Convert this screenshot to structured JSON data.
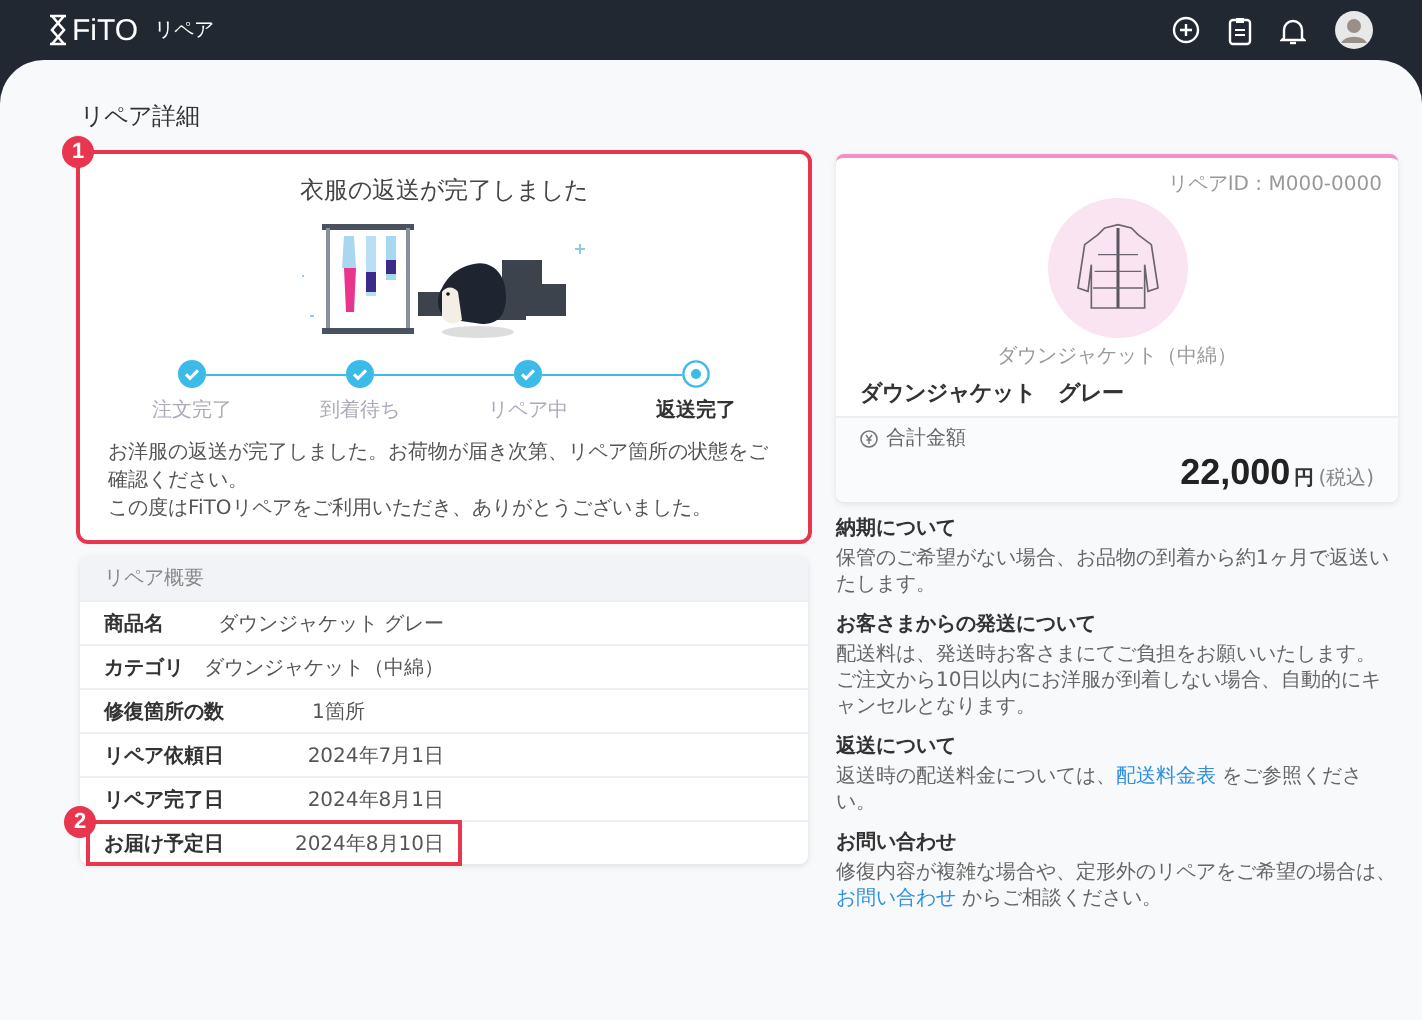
{
  "header": {
    "logo": "FiTO",
    "service": "リペア"
  },
  "page_title": "リペア詳細",
  "status_card": {
    "annotation": "1",
    "title": "衣服の返送が完了しました",
    "steps": [
      {
        "label": "注文完了",
        "done": true,
        "current": false
      },
      {
        "label": "到着待ち",
        "done": true,
        "current": false
      },
      {
        "label": "リペア中",
        "done": true,
        "current": false
      },
      {
        "label": "返送完了",
        "done": false,
        "current": true
      }
    ],
    "messages": [
      "お洋服の返送が完了しました。お荷物が届き次第、リペア箇所の状態をご確認ください。",
      "この度はFiTOリペアをご利用いただき、ありがとうございました。"
    ]
  },
  "summary": {
    "title": "リペア概要",
    "rows": [
      {
        "label": "商品名",
        "value": "ダウンジャケット グレー"
      },
      {
        "label": "カテゴリ",
        "value": "ダウンジャケット（中綿）"
      },
      {
        "label": "修復箇所の数",
        "value": "1箇所"
      },
      {
        "label": "リペア依頼日",
        "value": "2024年7月1日"
      },
      {
        "label": "リペア完了日",
        "value": "2024年8月1日"
      },
      {
        "label": "お届け予定日",
        "value": "2024年8月10日",
        "annotation": "2"
      }
    ]
  },
  "item_card": {
    "repair_id": "リペアID : M000-0000",
    "category": "ダウンジャケット（中綿）",
    "name": "ダウンジャケット　グレー",
    "total_label": "合計金額",
    "price": "22,000",
    "currency": "円",
    "tax_note": "(税込)"
  },
  "info_sections": [
    {
      "heading": "納期について",
      "paragraphs": [
        [
          {
            "text": "保管のご希望がない場合、お品物の到着から約1ヶ月で返送いたします。"
          }
        ]
      ]
    },
    {
      "heading": "お客さまからの発送について",
      "paragraphs": [
        [
          {
            "text": "配送料は、発送時お客さまにてご負担をお願いいたします。"
          }
        ],
        [
          {
            "text": "ご注文から10日以内にお洋服が到着しない場合、自動的にキャンセルとなります。"
          }
        ]
      ]
    },
    {
      "heading": "返送について",
      "paragraphs": [
        [
          {
            "text": "返送時の配送料金については、"
          },
          {
            "link": "配送料金表"
          },
          {
            "text": " をご参照ください。"
          }
        ]
      ]
    },
    {
      "heading": "お問い合わせ",
      "paragraphs": [
        [
          {
            "text": "修復内容が複雑な場合や、定形外のリペアをご希望の場合は、"
          }
        ],
        [
          {
            "link": "お問い合わせ"
          },
          {
            "text": " からご相談ください。"
          }
        ]
      ]
    }
  ]
}
